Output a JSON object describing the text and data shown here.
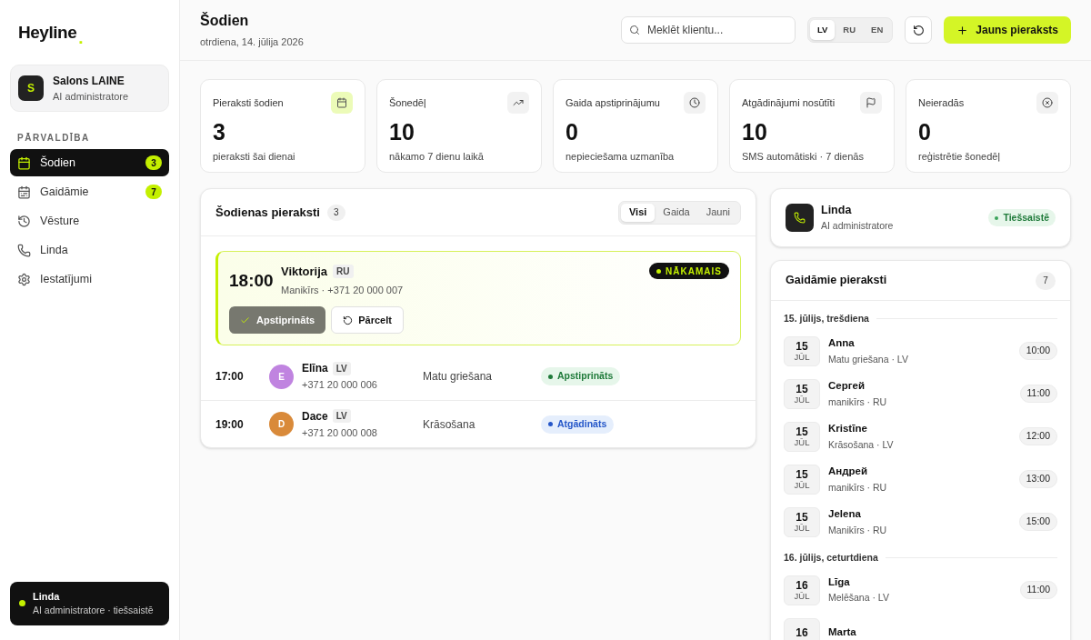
{
  "brand": {
    "name": "Heyline",
    "dot": "."
  },
  "salon": {
    "initial": "S",
    "name": "Salons LAINE",
    "role": "AI administratore"
  },
  "nav_heading": "PĀRVALDĪBA",
  "nav": [
    {
      "label": "Šodien",
      "badge": "3",
      "selected": true
    },
    {
      "label": "Gaidāmie",
      "badge": "7",
      "selected": false
    },
    {
      "label": "Vēsture",
      "selected": false
    },
    {
      "label": "Linda",
      "selected": false
    },
    {
      "label": "Iestatījumi",
      "selected": false
    }
  ],
  "agent_status": {
    "name": "Linda",
    "detail": "AI administratore · tiešsaistē",
    "online": true
  },
  "header": {
    "title": "Šodien",
    "date": "otrdiena, 14. jūlija 2026"
  },
  "search": {
    "placeholder": "Meklēt klientu..."
  },
  "languages": [
    {
      "label": "LV",
      "selected": true
    },
    {
      "label": "RU",
      "selected": false
    },
    {
      "label": "EN",
      "selected": false
    }
  ],
  "new_button": {
    "label": "Jauns pieraksts"
  },
  "stats": [
    {
      "label": "Pieraksti šodien",
      "value": "3",
      "note": "pieraksti šai dienai",
      "highlight": true
    },
    {
      "label": "Šonedēļ",
      "value": "10",
      "note": "nākamo 7 dienu laikā",
      "highlight": false
    },
    {
      "label": "Gaida apstiprinājumu",
      "value": "0",
      "note": "nepieciešama uzmanība",
      "highlight": false
    },
    {
      "label": "Atgādinājumi nosūtīti",
      "value": "10",
      "note": "SMS automātiski · 7 dienās",
      "highlight": false
    },
    {
      "label": "Neieradās",
      "value": "0",
      "note": "reģistrētie šonedēļ",
      "highlight": false
    }
  ],
  "today": {
    "title": "Šodienas pieraksti",
    "count": "3",
    "filters": [
      {
        "label": "Visi",
        "selected": true
      },
      {
        "label": "Gaida",
        "selected": false
      },
      {
        "label": "Jauni",
        "selected": false
      }
    ],
    "next": {
      "time": "18:00",
      "name": "Viktorija",
      "lang": "RU",
      "detail": "Manikīrs · +371 20 000 007",
      "badge": "NĀKAMAIS",
      "confirm": "Apstiprināts",
      "reschedule": "Pārcelt"
    },
    "rows": [
      {
        "time": "17:00",
        "initial": "E",
        "color": "#c084e0",
        "name": "Elīna",
        "lang": "LV",
        "phone": "+371 20 000 006",
        "service": "Matu griešana",
        "status": "Apstiprināts",
        "kind": "confirmed"
      },
      {
        "time": "19:00",
        "initial": "D",
        "color": "#d98a3a",
        "name": "Dace",
        "lang": "LV",
        "phone": "+371 20 000 008",
        "service": "Krāsošana",
        "status": "Atgādināts",
        "kind": "reminded"
      }
    ]
  },
  "agent_card": {
    "name": "Linda",
    "role": "AI administratore",
    "status": "Tiešsaistē"
  },
  "upcoming": {
    "title": "Gaidāmie pieraksti",
    "count": "7",
    "groups": [
      {
        "date": "15. jūlijs, trešdiena",
        "items": [
          {
            "day": "15",
            "month": "JŪL",
            "name": "Anna",
            "detail": "Matu griešana · LV",
            "time": "10:00"
          },
          {
            "day": "15",
            "month": "JŪL",
            "name": "Сергей",
            "detail": "manikīrs · RU",
            "time": "11:00"
          },
          {
            "day": "15",
            "month": "JŪL",
            "name": "Kristīne",
            "detail": "Krāsošana · LV",
            "time": "12:00"
          },
          {
            "day": "15",
            "month": "JŪL",
            "name": "Андрей",
            "detail": "manikīrs · RU",
            "time": "13:00"
          },
          {
            "day": "15",
            "month": "JŪL",
            "name": "Jelena",
            "detail": "Manikīrs · RU",
            "time": "15:00"
          }
        ]
      },
      {
        "date": "16. jūlijs, ceturtdiena",
        "items": [
          {
            "day": "16",
            "month": "JŪL",
            "name": "Līga",
            "detail": "Melēšana · LV",
            "time": "11:00"
          },
          {
            "day": "16",
            "name": "Marta"
          }
        ]
      }
    ]
  }
}
